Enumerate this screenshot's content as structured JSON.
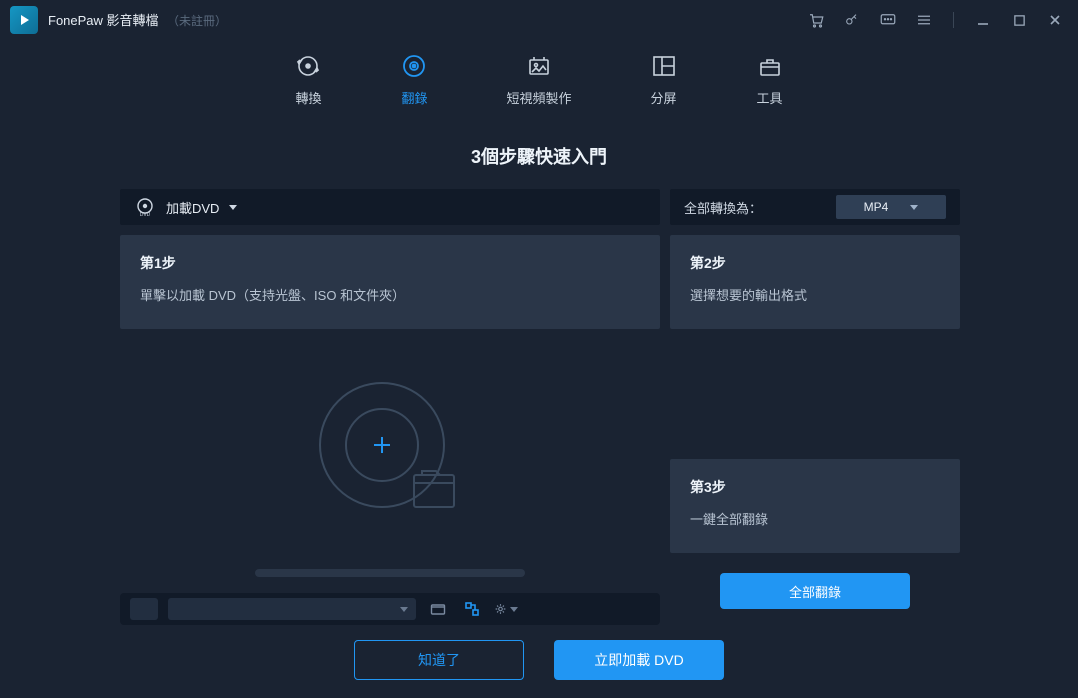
{
  "app": {
    "name": "FonePaw 影音轉檔",
    "status": "（未註冊）"
  },
  "nav": {
    "convert": "轉換",
    "rip": "翻錄",
    "short_video": "短視頻製作",
    "split": "分屏",
    "tools": "工具"
  },
  "heading": "3個步驟快速入門",
  "bar": {
    "load_dvd": "加載DVD",
    "convert_all_to": "全部轉換為：",
    "format_selected": "MP4"
  },
  "steps": {
    "s1_title": "第1步",
    "s1_desc": "單擊以加載 DVD（支持光盤、ISO 和文件夾）",
    "s2_title": "第2步",
    "s2_desc": "選擇想要的輸出格式",
    "s3_title": "第3步",
    "s3_desc": "一鍵全部翻錄"
  },
  "actions": {
    "rip_all": "全部翻錄",
    "got_it": "知道了",
    "load_dvd_now": "立即加載 DVD"
  }
}
